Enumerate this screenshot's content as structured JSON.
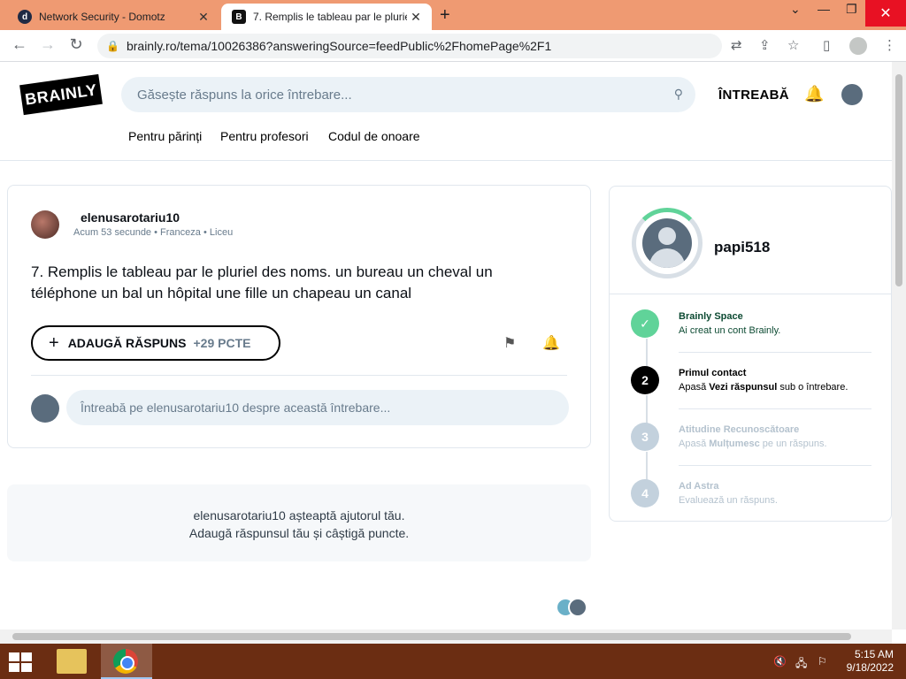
{
  "browser": {
    "tabs": [
      {
        "title": "Network Security - Domotz",
        "favicon": "d"
      },
      {
        "title": "7. Remplis le tableau par le plurie",
        "favicon": "B"
      }
    ],
    "url": "brainly.ro/tema/10026386?answeringSource=feedPublic%2FhomePage%2F1"
  },
  "header": {
    "logo": "BRAINLY",
    "search_placeholder": "Găsește răspuns la orice întrebare...",
    "ask_label": "ÎNTREABĂ",
    "subnav": [
      "Pentru părinți",
      "Pentru profesori",
      "Codul de onoare"
    ]
  },
  "question": {
    "author": "elenusarotariu10",
    "time": "Acum 53 secunde",
    "subject": "Franceza",
    "level": "Liceu",
    "text": "7. Remplis le tableau par le pluriel des noms. un bureau un cheval un téléphone un bal un hôpital une fille un chapeau un canal",
    "answer_label": "ADAUGĂ RĂSPUNS",
    "points": "+29 PCTE",
    "comment_placeholder": "Întreabă pe elenusarotariu10 despre această întrebare..."
  },
  "waiting": {
    "line1": "elenusarotariu10 așteaptă ajutorul tău.",
    "line2": "Adaugă răspunsul tău și câștigă puncte."
  },
  "profile": {
    "name": "papi518",
    "accent_color": "#60d399",
    "steps": [
      {
        "num": "✓",
        "title": "Brainly Space",
        "desc": "Ai creat un cont Brainly.",
        "state": "done"
      },
      {
        "num": "2",
        "title": "Primul contact",
        "desc_pre": "Apasă ",
        "desc_bold": "Vezi răspunsul",
        "desc_post": " sub o întrebare.",
        "state": "current"
      },
      {
        "num": "3",
        "title": "Atitudine Recunoscătoare",
        "desc_pre": "Apasă ",
        "desc_bold": "Mulțumesc",
        "desc_post": " pe un răspuns.",
        "state": "locked"
      },
      {
        "num": "4",
        "title": "Ad Astra",
        "desc": "Evaluează un răspuns.",
        "state": "locked"
      }
    ]
  },
  "taskbar": {
    "time": "5:15 AM",
    "date": "9/18/2022"
  }
}
